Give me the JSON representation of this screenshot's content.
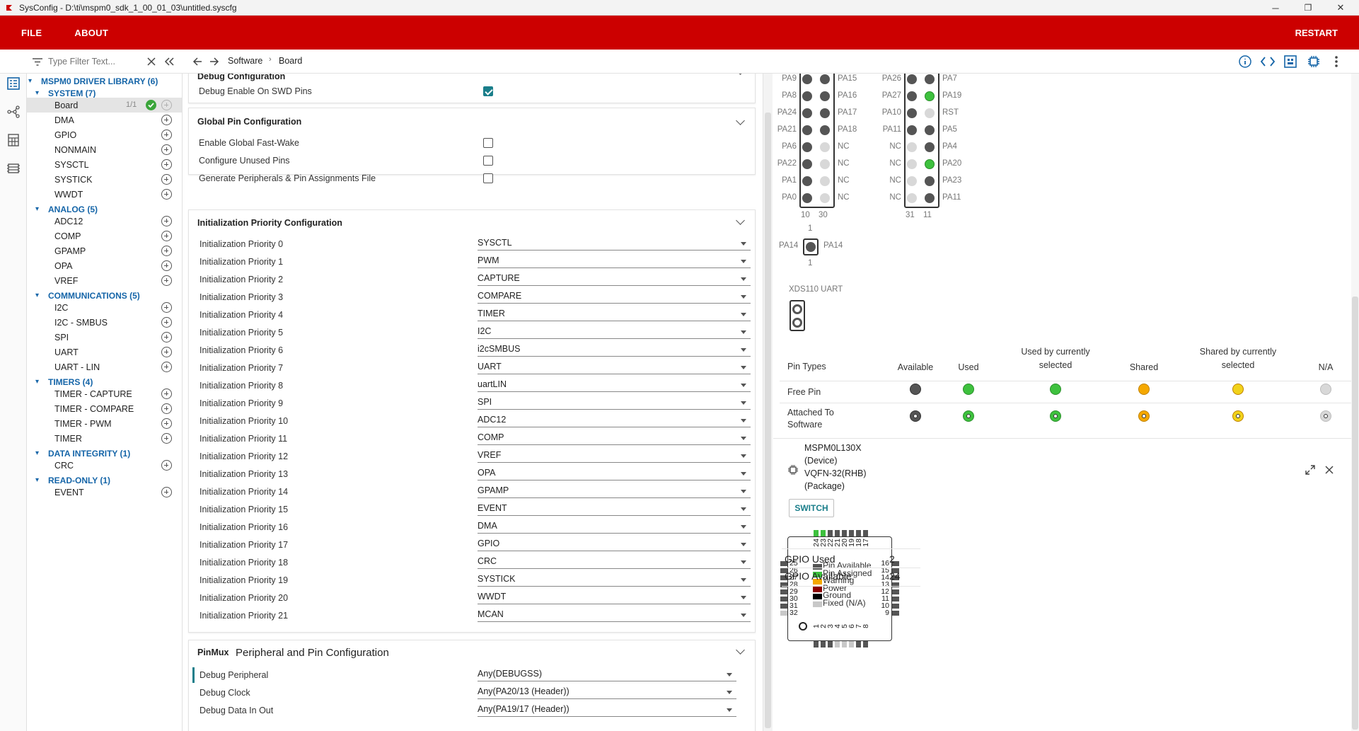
{
  "window": {
    "title": "SysConfig - D:\\ti\\mspm0_sdk_1_00_01_03\\untitled.syscfg",
    "minimize": "─",
    "maximize": "❐",
    "close": "✕"
  },
  "menu": {
    "file": "FILE",
    "about": "ABOUT",
    "restart": "RESTART"
  },
  "toolbar": {
    "filter_placeholder": "Type Filter Text...",
    "breadcrumb": [
      "Software",
      "Board"
    ]
  },
  "tree": {
    "root": "MSPM0 DRIVER LIBRARY (6)",
    "categories": [
      {
        "label": "SYSTEM (7)",
        "items": [
          "Board",
          "DMA",
          "GPIO",
          "NONMAIN",
          "SYSCTL",
          "SYSTICK",
          "WWDT"
        ]
      },
      {
        "label": "ANALOG (5)",
        "items": [
          "ADC12",
          "COMP",
          "GPAMP",
          "OPA",
          "VREF"
        ]
      },
      {
        "label": "COMMUNICATIONS (5)",
        "items": [
          "I2C",
          "I2C - SMBUS",
          "SPI",
          "UART",
          "UART - LIN"
        ]
      },
      {
        "label": "TIMERS (4)",
        "items": [
          "TIMER - CAPTURE",
          "TIMER - COMPARE",
          "TIMER - PWM",
          "TIMER"
        ]
      },
      {
        "label": "DATA INTEGRITY (1)",
        "items": [
          "CRC"
        ]
      },
      {
        "label": "READ-ONLY (1)",
        "items": [
          "EVENT"
        ]
      }
    ],
    "board_count": "1/1"
  },
  "debug_config": {
    "title": "Debug Configuration",
    "swd_label": "Debug Enable On SWD Pins",
    "swd_checked": true
  },
  "global_pin": {
    "title": "Global Pin Configuration",
    "options": [
      {
        "label": "Enable Global Fast-Wake",
        "checked": false
      },
      {
        "label": "Configure Unused Pins",
        "checked": false
      },
      {
        "label": "Generate Peripherals & Pin Assignments File",
        "checked": false
      }
    ]
  },
  "init_priority": {
    "title": "Initialization Priority Configuration",
    "rows": [
      {
        "label": "Initialization Priority 0",
        "value": "SYSCTL"
      },
      {
        "label": "Initialization Priority 1",
        "value": "PWM"
      },
      {
        "label": "Initialization Priority 2",
        "value": "CAPTURE"
      },
      {
        "label": "Initialization Priority 3",
        "value": "COMPARE"
      },
      {
        "label": "Initialization Priority 4",
        "value": "TIMER"
      },
      {
        "label": "Initialization Priority 5",
        "value": "I2C"
      },
      {
        "label": "Initialization Priority 6",
        "value": "i2cSMBUS"
      },
      {
        "label": "Initialization Priority 7",
        "value": "UART"
      },
      {
        "label": "Initialization Priority 8",
        "value": "uartLIN"
      },
      {
        "label": "Initialization Priority 9",
        "value": "SPI"
      },
      {
        "label": "Initialization Priority 10",
        "value": "ADC12"
      },
      {
        "label": "Initialization Priority 11",
        "value": "COMP"
      },
      {
        "label": "Initialization Priority 12",
        "value": "VREF"
      },
      {
        "label": "Initialization Priority 13",
        "value": "OPA"
      },
      {
        "label": "Initialization Priority 14",
        "value": "GPAMP"
      },
      {
        "label": "Initialization Priority 15",
        "value": "EVENT"
      },
      {
        "label": "Initialization Priority 16",
        "value": "DMA"
      },
      {
        "label": "Initialization Priority 17",
        "value": "GPIO"
      },
      {
        "label": "Initialization Priority 18",
        "value": "CRC"
      },
      {
        "label": "Initialization Priority 19",
        "value": "SYSTICK"
      },
      {
        "label": "Initialization Priority 20",
        "value": "WWDT"
      },
      {
        "label": "Initialization Priority 21",
        "value": "MCAN"
      }
    ]
  },
  "pinmux": {
    "prefix": "PinMux",
    "title": "Peripheral and Pin Configuration",
    "rows": [
      {
        "label": "Debug Peripheral",
        "value": "Any(DEBUGSS)"
      },
      {
        "label": "Debug Clock",
        "value": "Any(PA20/13 (Header))"
      },
      {
        "label": "Debug Data In Out",
        "value": "Any(PA19/17 (Header))"
      }
    ]
  },
  "header_left": {
    "left_labels": [
      "PA9",
      "PA8",
      "PA24",
      "PA21",
      "PA6",
      "PA22",
      "PA1",
      "PA0"
    ],
    "right_labels": [
      "PA15",
      "PA16",
      "PA17",
      "PA18",
      "NC",
      "NC",
      "NC",
      "NC"
    ],
    "pin_states": [
      [
        "d",
        "d"
      ],
      [
        "d",
        "d"
      ],
      [
        "d",
        "d"
      ],
      [
        "d",
        "d"
      ],
      [
        "d",
        "l"
      ],
      [
        "d",
        "l"
      ],
      [
        "d",
        "l"
      ],
      [
        "d",
        "l"
      ]
    ],
    "bottom": [
      "10",
      "30"
    ]
  },
  "header_right": {
    "left_labels": [
      "PA26",
      "PA27",
      "PA10",
      "PA11",
      "NC",
      "NC",
      "NC",
      "NC"
    ],
    "right_labels": [
      "PA7",
      "PA19",
      "RST",
      "PA5",
      "PA4",
      "PA20",
      "PA23",
      "PA11"
    ],
    "pin_states": [
      [
        "d",
        "d"
      ],
      [
        "d",
        "g"
      ],
      [
        "d",
        "l"
      ],
      [
        "d",
        "d"
      ],
      [
        "l",
        "d"
      ],
      [
        "l",
        "g"
      ],
      [
        "l",
        "d"
      ],
      [
        "l",
        "d"
      ]
    ],
    "bottom": [
      "31",
      "11"
    ]
  },
  "header_single": {
    "top": "1",
    "bottom": "1",
    "left": "PA14",
    "right": "PA14"
  },
  "xds_label": "XDS110 UART",
  "legend": {
    "col_title": "Pin Types",
    "columns": [
      "Available",
      "Used",
      "Used by currently selected",
      "Shared",
      "Shared by currently selected",
      "N/A"
    ],
    "rows": [
      "Free Pin",
      "Attached To Software"
    ],
    "colors": [
      "#555555",
      "#3ec13e",
      "#3ec13e",
      "#f5a800",
      "#f1d21a",
      "#d8d8d8"
    ]
  },
  "device": {
    "name": "MSPM0L130X",
    "name_sub": "(Device)",
    "package": "VQFN-32(RHB)",
    "package_sub": "(Package)",
    "switch_label": "SWITCH",
    "top_pins": [
      "24",
      "23",
      "22",
      "21",
      "20",
      "19",
      "18",
      "17"
    ],
    "left_pins": [
      "25",
      "26",
      "27",
      "28",
      "29",
      "30",
      "31",
      "32"
    ],
    "right_pins": [
      "16",
      "15",
      "14",
      "13",
      "12",
      "11",
      "10",
      "9"
    ],
    "bottom_pins": [
      "1",
      "2",
      "3",
      "4",
      "5",
      "6",
      "7",
      "8"
    ],
    "key": [
      {
        "label": "Pin Available",
        "color": "#555555"
      },
      {
        "label": "Pin Assigned",
        "color": "#3ec13e"
      },
      {
        "label": "Warning",
        "color": "#f5a800"
      },
      {
        "label": "Power",
        "color": "#8b0000"
      },
      {
        "label": "Ground",
        "color": "#000000"
      },
      {
        "label": "Fixed (N/A)",
        "color": "#c8c8c8"
      }
    ]
  },
  "stats": [
    {
      "label": "GPIO Used",
      "value": "2"
    },
    {
      "label": "GPIO Available",
      "value": "24"
    }
  ]
}
